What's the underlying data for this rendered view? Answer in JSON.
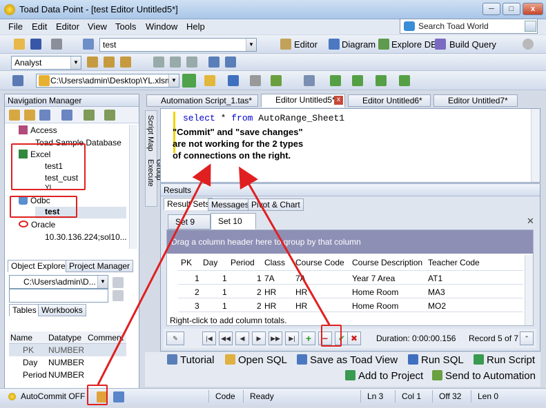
{
  "window": {
    "title": "Toad Data Point - [test Editor Untitled5*]",
    "min": "─",
    "max": "□",
    "close": "x"
  },
  "menu": [
    "File",
    "Edit",
    "Editor",
    "View",
    "Tools",
    "Window",
    "Help"
  ],
  "search": {
    "label": "Search Toad World"
  },
  "toolbar1": {
    "connection": "test",
    "editor": "Editor",
    "diagram": "Diagram",
    "explore": "Explore DB",
    "query": "Build Query"
  },
  "toolbar2": {
    "role": "Analyst"
  },
  "toolbar3": {
    "path": "C:\\Users\\admin\\Desktop\\YL.xlsm"
  },
  "nav": {
    "title": "Navigation Manager",
    "tree": [
      "Access",
      "Toad Sample Database",
      "Excel",
      "test1",
      "test_cust",
      "YL",
      "Odbc",
      "test",
      "Oracle",
      "10.30.136.224;sol10..."
    ]
  },
  "explorer": {
    "tab1": "Object Explorer",
    "tab2": "Project Manager",
    "path": "C:\\Users\\admin\\D...",
    "tab3": "Tables",
    "tab4": "Workbooks",
    "headers": [
      "Name",
      "Datatype",
      "Comment"
    ],
    "rows": [
      [
        "PK",
        "NUMBER"
      ],
      [
        "Day",
        "NUMBER"
      ],
      [
        "Period",
        "NUMBER"
      ]
    ]
  },
  "side_tabs": [
    "Script Map",
    "Group Execute"
  ],
  "editor_tabs": [
    "Automation Script_1.tas*",
    "Editor Untitled5*",
    "Editor Untitled6*",
    "Editor Untitled7*"
  ],
  "code": {
    "kw": "select",
    "star": "*",
    "from": "from",
    "table": "AutoRange_Sheet1"
  },
  "annotation": [
    "\"Commit\" and \"save changes\"",
    "are not working for the 2 types",
    "of connections on the right."
  ],
  "results": {
    "title": "Results",
    "tabs": [
      "Result Sets",
      "Messages",
      "Pivot & Chart"
    ],
    "sets": [
      "Set 9",
      "Set 10"
    ],
    "group_hint": "Drag a column header here to group by that column",
    "columns": [
      "PK",
      "Day",
      "Period",
      "Class",
      "Course Code",
      "Course Description",
      "Teacher Code"
    ],
    "rows": [
      [
        "1",
        "1",
        "1",
        "7A",
        "7A",
        "Year 7 Area",
        "AT1"
      ],
      [
        "2",
        "1",
        "2",
        "HR",
        "HR",
        "Home Room",
        "MA3"
      ],
      [
        "3",
        "1",
        "2",
        "HR",
        "HR",
        "Home Room",
        "MO2"
      ]
    ],
    "footer_hint": "Right-click to add column totals.",
    "duration": "Duration: 0:00:00.156",
    "record": "Record 5 of 7"
  },
  "actions": {
    "tutorial": "Tutorial",
    "opensql": "Open SQL",
    "saveview": "Save as Toad View",
    "runsql": "Run SQL",
    "runscript": "Run Script",
    "addproject": "Add to Project",
    "sendauto": "Send to Automation"
  },
  "status": {
    "autocommit": "AutoCommit OFF",
    "mode": "Code",
    "state": "Ready",
    "ln": "Ln 3",
    "col": "Col 1",
    "off": "Off 32",
    "len": "Len 0"
  }
}
